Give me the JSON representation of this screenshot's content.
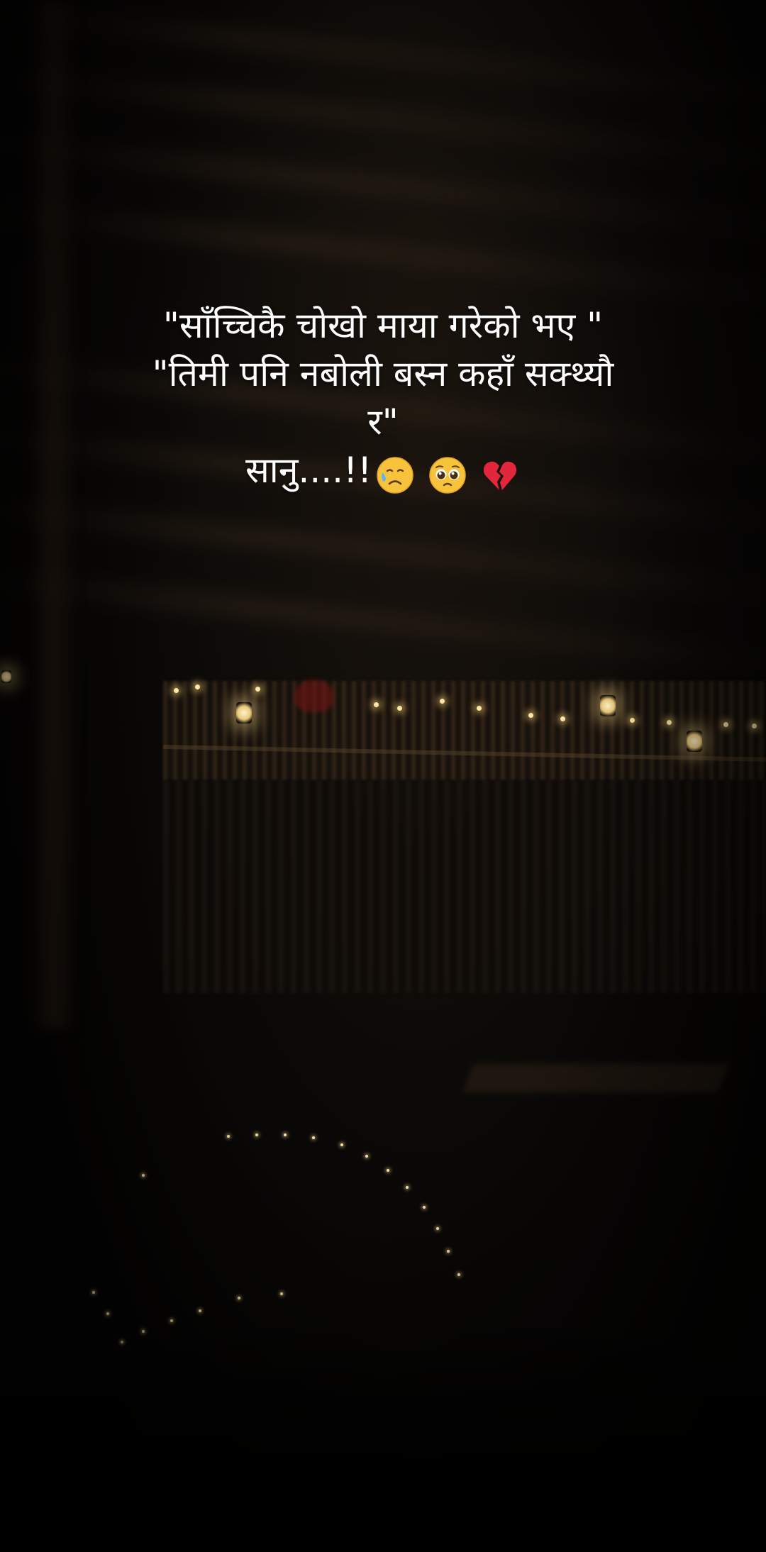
{
  "caption": {
    "line1": "\"साँच्चिकै चोखो माया गरेको भए \"",
    "line2": "\"तिमी पनि नबोली बस्न कहाँ सक्थ्याै",
    "line3": "र\"",
    "line4": "सानु....!!"
  },
  "emojis": [
    "sad-relieved-face-icon",
    "pleading-face-icon",
    "broken-heart-icon"
  ],
  "colors": {
    "text": "#ffffff",
    "background": "#000000",
    "light_glow": "#ffe7a8"
  }
}
